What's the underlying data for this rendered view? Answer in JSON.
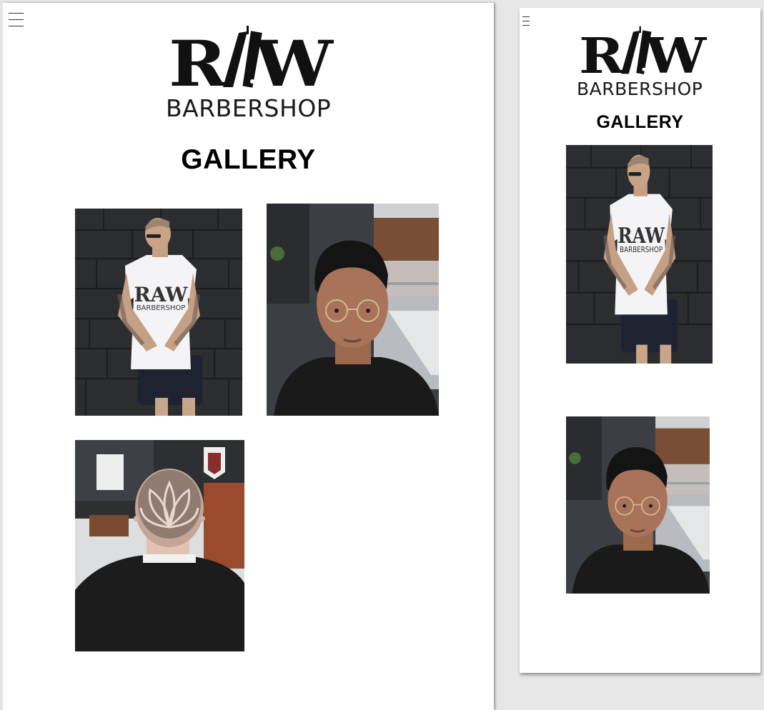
{
  "brand": {
    "logo_word": "RAW",
    "logo_sub": "BARBERSHOP"
  },
  "desktop": {
    "page_title": "GALLERY",
    "photos": [
      {
        "name": "model-tshirt-photo",
        "shirt_word": "RAW",
        "shirt_sub": "BARBERSHOP"
      },
      {
        "name": "client-glasses-photo"
      },
      {
        "name": "hair-design-photo"
      }
    ]
  },
  "mobile": {
    "page_title": "GALLERY",
    "photos": [
      {
        "name": "model-tshirt-photo",
        "shirt_word": "RAW",
        "shirt_sub": "BARBERSHOP"
      },
      {
        "name": "client-glasses-photo"
      }
    ]
  },
  "colors": {
    "canvas": "#e6e6e6",
    "page": "#ffffff",
    "brick_wall": "#2b2d30",
    "text": "#000000"
  }
}
